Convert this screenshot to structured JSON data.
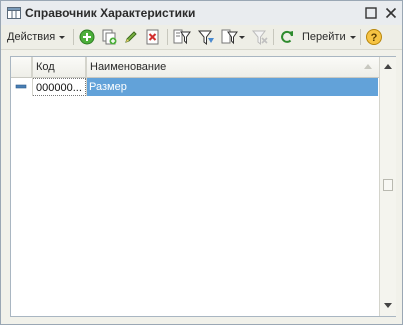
{
  "window": {
    "title": "Справочник Характеристики"
  },
  "toolbar": {
    "actions_label": "Действия",
    "goto_label": "Перейти",
    "icons": [
      "add-icon",
      "copy-icon",
      "edit-icon",
      "delete-icon",
      "filter-icon",
      "filter-by-value-icon",
      "filter-dropdown-icon",
      "clear-filter-icon",
      "refresh-icon",
      "help-icon"
    ]
  },
  "grid": {
    "columns": [
      "Код",
      "Наименование"
    ],
    "rows": [
      {
        "code": "000000...",
        "name": "Размер",
        "selected": true
      }
    ]
  },
  "colors": {
    "selection": "#62a2d9",
    "titlebar": "#e9ecef",
    "toolbar": "#eeeee6"
  }
}
